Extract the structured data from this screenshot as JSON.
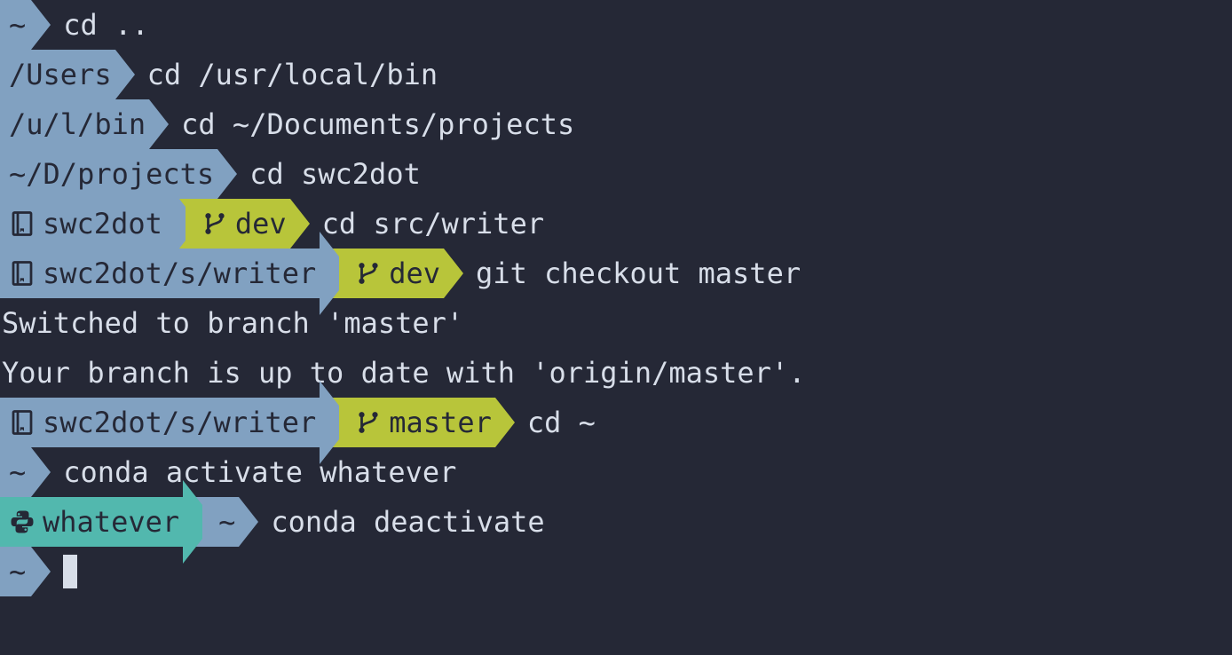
{
  "lines": [
    {
      "segments": [
        {
          "type": "blue",
          "text": "~",
          "first": true
        }
      ],
      "command": "cd .."
    },
    {
      "segments": [
        {
          "type": "blue",
          "text": "/Users",
          "first": true
        }
      ],
      "command": "cd /usr/local/bin"
    },
    {
      "segments": [
        {
          "type": "blue",
          "text": "/u/l/bin",
          "first": true
        }
      ],
      "command": "cd ~/Documents/projects"
    },
    {
      "segments": [
        {
          "type": "blue",
          "text": "~/D/projects",
          "first": true
        }
      ],
      "command": "cd swc2dot"
    },
    {
      "segments": [
        {
          "type": "blue",
          "icon": "repo",
          "text": "swc2dot",
          "first": true
        },
        {
          "type": "green",
          "icon": "branch",
          "text": "dev"
        }
      ],
      "command": "cd src/writer"
    },
    {
      "segments": [
        {
          "type": "blue",
          "icon": "repo",
          "text": "swc2dot/s/writer",
          "first": true
        },
        {
          "type": "green",
          "icon": "branch",
          "text": "dev"
        }
      ],
      "command": "git checkout master"
    },
    {
      "output": "Switched to branch 'master'"
    },
    {
      "output": "Your branch is up to date with 'origin/master'."
    },
    {
      "segments": [
        {
          "type": "blue",
          "icon": "repo",
          "text": "swc2dot/s/writer",
          "first": true
        },
        {
          "type": "green",
          "icon": "branch",
          "text": "master"
        }
      ],
      "command": "cd ~"
    },
    {
      "segments": [
        {
          "type": "blue",
          "text": "~",
          "first": true
        }
      ],
      "command": "conda activate whatever"
    },
    {
      "segments": [
        {
          "type": "teal",
          "icon": "python",
          "text": "whatever",
          "first": true
        },
        {
          "type": "blue",
          "text": "~"
        }
      ],
      "command": "conda deactivate"
    },
    {
      "segments": [
        {
          "type": "blue",
          "text": "~",
          "first": true
        }
      ],
      "cursor": true
    }
  ]
}
